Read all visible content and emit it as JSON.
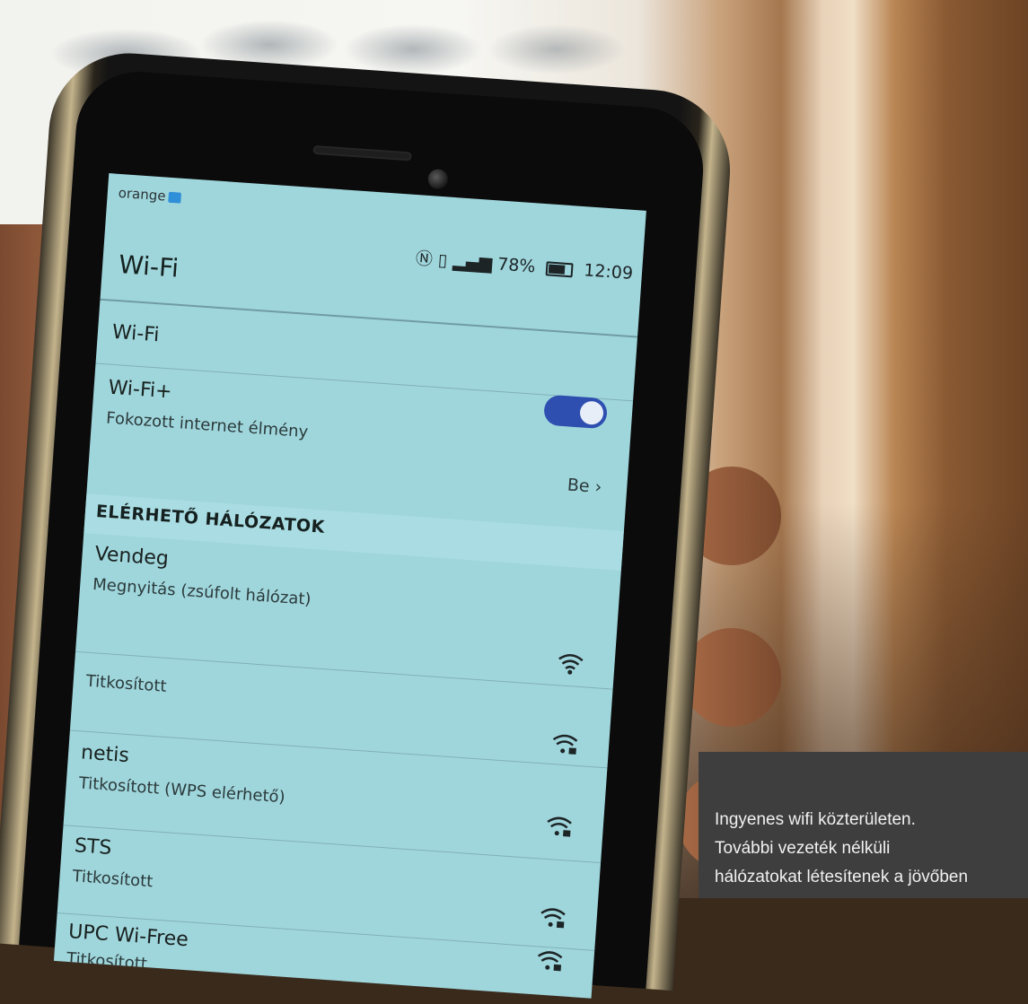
{
  "status_bar": {
    "carrier": "orange",
    "battery_percent": "78%",
    "time": "12:09"
  },
  "app_bar": {
    "title": "Wi-Fi"
  },
  "settings": {
    "wifi_label": "Wi-Fi",
    "wifi_plus_label": "Wi-Fi+",
    "wifi_plus_sublabel": "Fokozott internet élmény",
    "wifi_plus_value": "Be",
    "wifi_toggle_on": true
  },
  "networks_section": {
    "title": "ELÉRHETŐ HÁLÓZATOK",
    "items": [
      {
        "name": "Vendeg",
        "status": "Megnyitás (zsúfolt hálózat)",
        "locked": false
      },
      {
        "name": "",
        "status": "Titkosított",
        "locked": true
      },
      {
        "name": "netis",
        "status": "Titkosított (WPS elérhető)",
        "locked": true
      },
      {
        "name": "STS",
        "status": "Titkosított",
        "locked": true
      },
      {
        "name": "UPC Wi-Free",
        "status": "Titkosított",
        "locked": true
      }
    ]
  },
  "caption": {
    "text": "Ingyenes wifi közterületen.\nTovábbi vezeték nélküli\nhálózatokat létesítenek a jövőben"
  },
  "colors": {
    "screen": "#9fd6dc",
    "toggle": "#2e4fb0",
    "caption_bg": "#3e3e3f"
  }
}
